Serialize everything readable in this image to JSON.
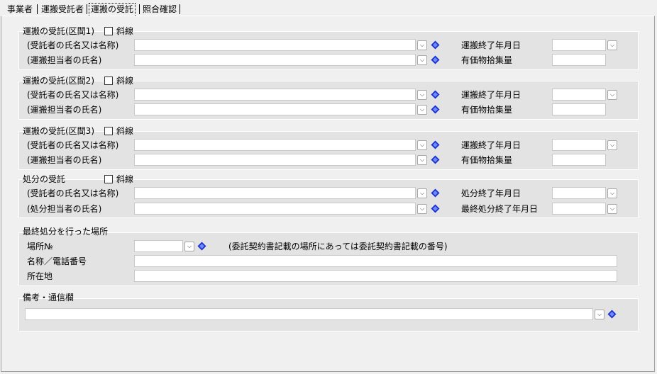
{
  "tabs": [
    "事業者",
    "運搬受託者",
    "運搬の受託",
    "照合確認"
  ],
  "sections": [
    {
      "title": "運搬の受託(区間1)",
      "check_label": "斜線",
      "row1_label": "(受託者の氏名又は名称)",
      "row2_label": "(運搬担当者の氏名)",
      "right1_label": "運搬終了年月日",
      "right2_label": "有価物拾集量"
    },
    {
      "title": "運搬の受託(区間2)",
      "check_label": "斜線",
      "row1_label": "(受託者の氏名又は名称)",
      "row2_label": "(運搬担当者の氏名)",
      "right1_label": "運搬終了年月日",
      "right2_label": "有価物拾集量"
    },
    {
      "title": "運搬の受託(区間3)",
      "check_label": "斜線",
      "row1_label": "(受託者の氏名又は名称)",
      "row2_label": "(運搬担当者の氏名)",
      "right1_label": "運搬終了年月日",
      "right2_label": "有価物拾集量"
    },
    {
      "title": "処分の受託",
      "check_label": "斜線",
      "row1_label": "(受託者の氏名又は名称)",
      "row2_label": "(処分担当者の氏名)",
      "right1_label": "処分終了年月日",
      "right2_label": "最終処分終了年月日"
    }
  ],
  "final_place": {
    "title": "最終処分を行った場所",
    "place_no_label": "場所№",
    "note": "(委託契約書記載の場所にあっては委託契約書記載の番号)",
    "name_label": "名称／電話番号",
    "address_label": "所在地"
  },
  "remarks": {
    "title": "備考・通信欄"
  },
  "colors": {
    "background": "#f0f0f0",
    "panel": "#e3e3e3",
    "diamond": "#1a2fd0"
  }
}
